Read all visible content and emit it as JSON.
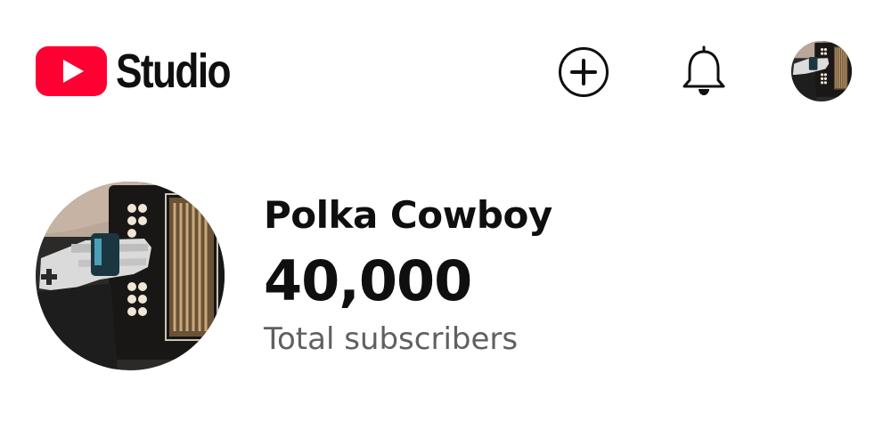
{
  "header": {
    "logo_text": "Studio",
    "logo_icon": "youtube-play-icon",
    "brand_color": "#ff0033",
    "create_icon": "plus-circle-icon",
    "notifications_icon": "bell-icon",
    "account_icon": "avatar"
  },
  "channel": {
    "name": "Polka Cowboy",
    "subscriber_count": "40,000",
    "subscriber_label": "Total subscribers"
  }
}
